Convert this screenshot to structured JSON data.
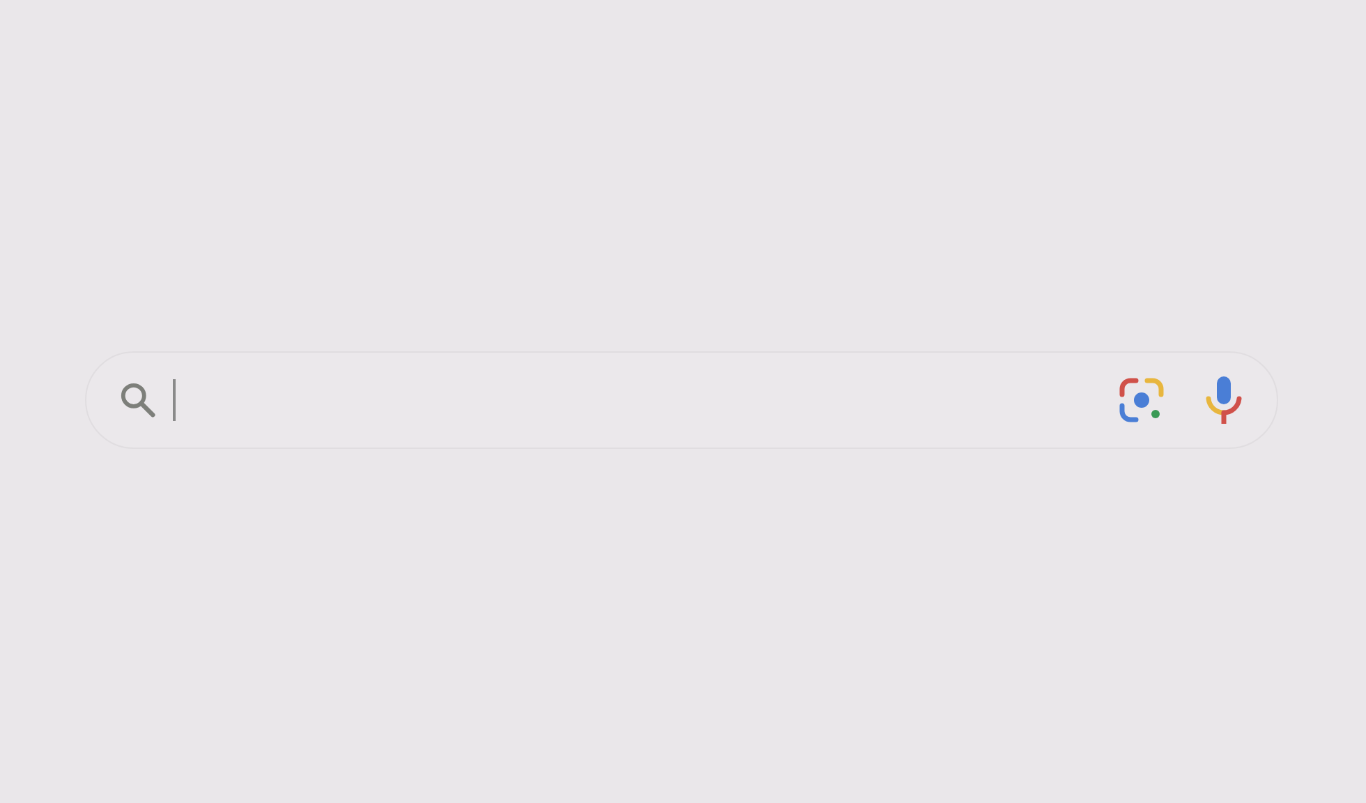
{
  "search_bar": {
    "focused": true
  }
}
